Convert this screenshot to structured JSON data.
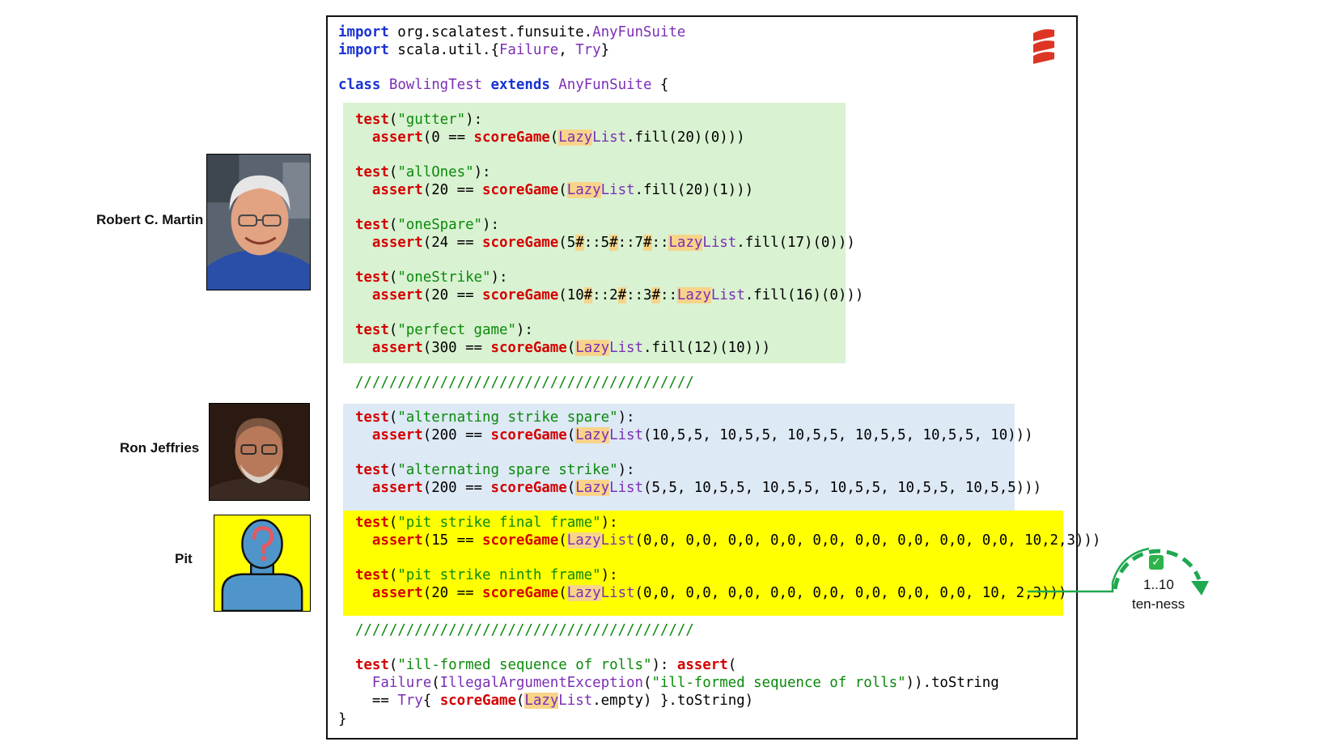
{
  "people": [
    {
      "name": "Robert C. Martin"
    },
    {
      "name": "Ron Jeffries"
    },
    {
      "name": "Pit"
    }
  ],
  "code": {
    "lines": [
      [
        "import",
        " org.scalatest.funsuite.",
        "AnyFunSuite"
      ],
      [
        "import",
        " scala.util.{",
        "Failure",
        ", ",
        "Try",
        "}"
      ],
      [
        "class",
        " ",
        "BowlingTest",
        " ",
        "extends",
        " ",
        "AnyFunSuite",
        " {"
      ]
    ],
    "tests_green": [
      {
        "name": "\"gutter\"",
        "assert_pre": "assert",
        "expr": "(0 == ",
        "fn": "scoreGame",
        "open": "(",
        "ll": "Lazy",
        "ll2": "List",
        "rest": ".fill(20)(0)))"
      },
      {
        "name": "\"allOnes\"",
        "assert_pre": "assert",
        "expr": "(20 == ",
        "fn": "scoreGame",
        "open": "(",
        "ll": "Lazy",
        "ll2": "List",
        "rest": ".fill(20)(1)))"
      },
      {
        "name": "\"oneSpare\"",
        "assert_pre": "assert",
        "expr": "(24 == ",
        "fn": "scoreGame",
        "open": "(5",
        "ll": "Lazy",
        "ll2": "List",
        "rest": ".fill(17)(0)))"
      },
      {
        "name": "\"oneStrike\"",
        "assert_pre": "assert",
        "expr": "(20 == ",
        "fn": "scoreGame",
        "open": "(10",
        "ll": "Lazy",
        "ll2": "List",
        "rest": ".fill(16)(0)))"
      },
      {
        "name": "\"perfect game\"",
        "assert_pre": "assert",
        "expr": "(300 == ",
        "fn": "scoreGame",
        "open": "(",
        "ll": "Lazy",
        "ll2": "List",
        "rest": ".fill(12)(10)))"
      }
    ],
    "separator": "////////////////////////////////////////",
    "tests_blue": [
      {
        "name": "\"alternating strike spare\"",
        "expr": "(200 == ",
        "rest": "(10,5,5, 10,5,5, 10,5,5, 10,5,5, 10,5,5, 10)))"
      },
      {
        "name": "\"alternating spare strike\"",
        "expr": "(200 == ",
        "rest": "(5,5, 10,5,5, 10,5,5, 10,5,5, 10,5,5, 10,5,5)))"
      }
    ],
    "tests_yellow": [
      {
        "name": "\"pit strike final frame\"",
        "expr": "(15 == ",
        "rest": "(0,0, 0,0, 0,0, 0,0, 0,0, 0,0, 0,0, 0,0, 0,0, 10,2,3)))"
      },
      {
        "name": "\"pit strike ninth frame\"",
        "expr": "(20 == ",
        "rest": "(0,0, 0,0, 0,0, 0,0, 0,0, 0,0, 0,0, 0,0, 10, 2,3)))"
      }
    ],
    "ill": {
      "name": "\"ill-formed sequence of rolls\"",
      "failure": "Failure",
      "exc": "IllegalArgumentException",
      "msg": "\"ill-formed sequence of rolls\"",
      "tail1": ")).toString",
      "eq": "== ",
      "try": "Try",
      "brace": "{ ",
      "empty": ".empty) }.toString)"
    },
    "closing": "}"
  },
  "badge": {
    "range": "1..10",
    "label": "ten-ness"
  },
  "colors": {
    "green_bg": "#d9f2d2",
    "blue_bg": "#dde9f5",
    "yellow_bg": "#ffff00",
    "connector": "#1fa84f",
    "highlight": "#f7d48a"
  }
}
